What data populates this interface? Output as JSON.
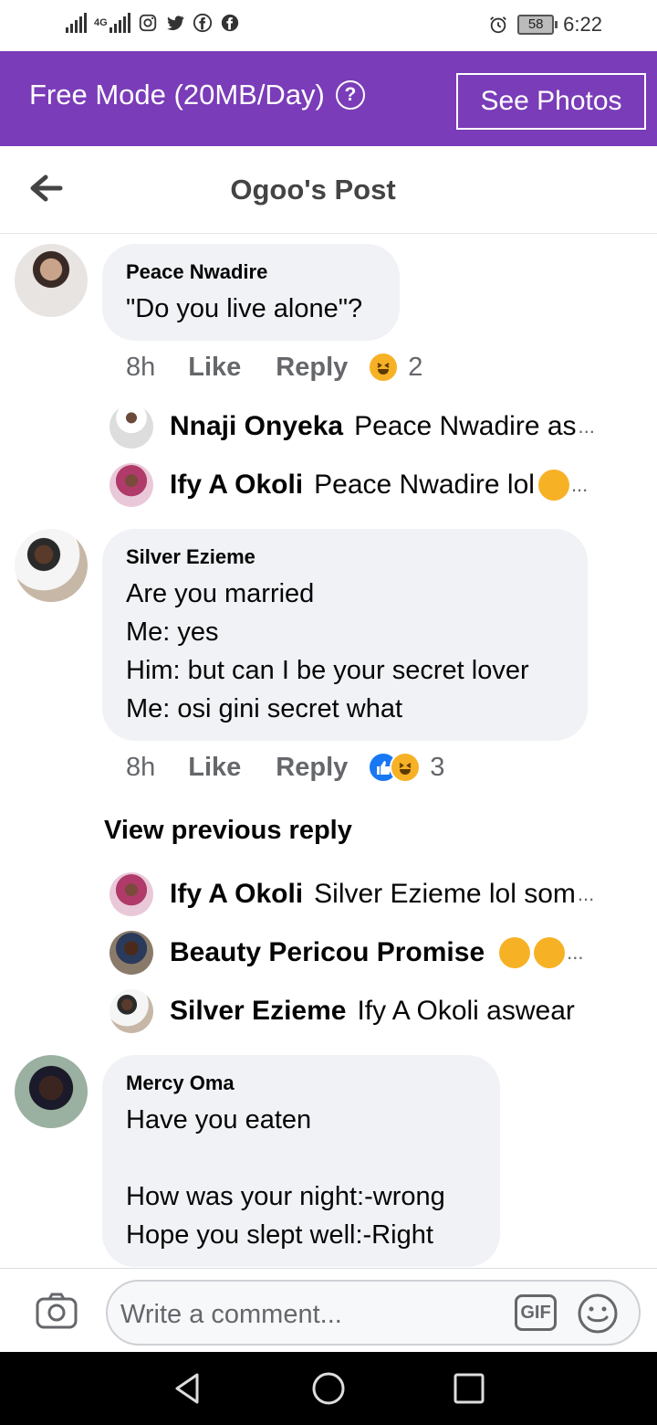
{
  "status_bar": {
    "network": "4G",
    "battery": "58",
    "time": "6:22"
  },
  "banner": {
    "text": "Free Mode (20MB/Day)",
    "help_icon": "?",
    "button": "See Photos",
    "color": "#7a3cb8"
  },
  "header": {
    "title": "Ogoo's Post"
  },
  "comments": [
    {
      "name": "Peace Nwadire",
      "body": "\"Do you live alone\"?",
      "time": "8h",
      "like": "Like",
      "reply": "Reply",
      "reaction_count": "2",
      "replies": [
        {
          "name": "Nnaji Onyeka",
          "text": "Peace Nwadire as"
        },
        {
          "name": "Ify A Okoli",
          "text": "Peace Nwadire lol"
        }
      ]
    },
    {
      "name": "Silver Ezieme",
      "body": "Are you married\nMe: yes\nHim: but can I be your secret lover\nMe: osi gini secret what",
      "time": "8h",
      "like": "Like",
      "reply": "Reply",
      "reaction_count": "3",
      "view_previous": "View previous reply",
      "replies": [
        {
          "name": "Ify A Okoli",
          "text": "Silver Ezieme lol som"
        },
        {
          "name": "Beauty Pericou Promise",
          "text": ""
        },
        {
          "name": "Silver Ezieme",
          "text": "Ify A Okoli aswear"
        }
      ]
    },
    {
      "name": "Mercy Oma",
      "body": "Have you eaten\n\nHow was your night:-wrong\nHope you slept well:-Right"
    }
  ],
  "composer": {
    "placeholder": "Write a comment...",
    "gif": "GIF"
  }
}
